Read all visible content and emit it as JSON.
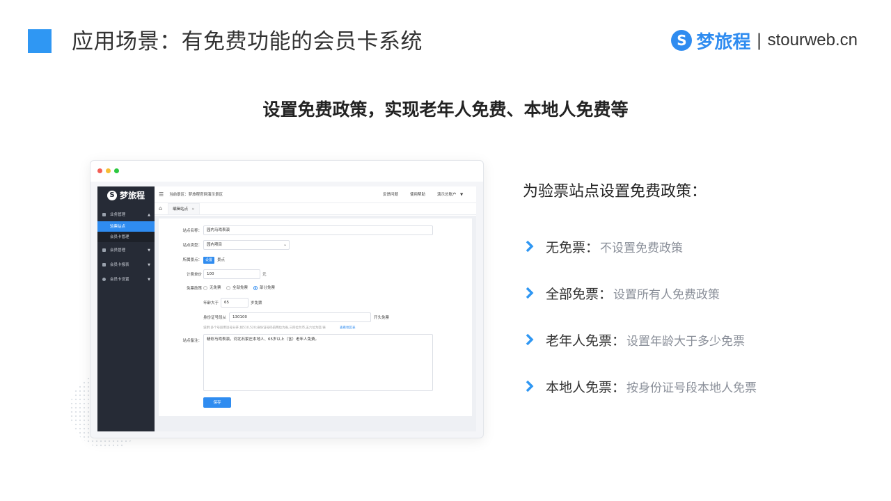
{
  "header": {
    "title": "应用场景：有免费功能的会员卡系统",
    "brand_name": "梦旅程",
    "brand_separator": "|",
    "brand_domain": "stourweb.cn",
    "accent_color": "#2f97f3"
  },
  "subtitle": "设置免费政策，实现老年人免费、本地人免费等",
  "app": {
    "logo_text": "梦旅程",
    "logo_letter": "S",
    "breadcrumb": "当前景区：梦旅程官网演示景区",
    "top_links": [
      "反馈问题",
      "使用帮助",
      "演示总账户"
    ],
    "top_caret": "▼",
    "menu_icon": "☰",
    "home_icon": "⌂",
    "tab_label": "编辑站点",
    "tab_close": "×",
    "sidebar": {
      "groups": [
        {
          "label": "业务管理",
          "caret": "▲"
        },
        {
          "label": "会员管理",
          "caret": "▼"
        },
        {
          "label": "会员卡报表",
          "caret": "▼"
        },
        {
          "label": "会员卡设置",
          "caret": "▼"
        }
      ],
      "sub_items": [
        "验票站点",
        "会员卡管理"
      ]
    },
    "form": {
      "site_name_label": "站点名称：",
      "site_name_value": "园内马戏表演",
      "site_type_label": "站点类型：",
      "site_type_value": "园内项目",
      "select_caret": "⌄",
      "scenic_label": "所属景点：",
      "scenic_tag": "设置",
      "scenic_plain": "景点",
      "price_label": "计费单价",
      "price_value": "100",
      "price_unit": "元",
      "free_policy_label": "免票政策",
      "policy_options": [
        "无免票",
        "全部免票",
        "部分免票"
      ],
      "age_label": "年龄大于",
      "age_value": "65",
      "age_suffix": "岁免票",
      "id_label": "身份证号段从",
      "id_value": "130100",
      "id_suffix": "开头免票",
      "id_hint": "说明:多个号段用逗号分开,如510,520;身份证号码前两位为省,三四位为市,五六位为区/县",
      "id_hint_link": "查看地区表",
      "note_label": "站点备注：",
      "note_value": "精彩马戏表演，河北石家庄本地人、65岁以上（含）老年人免费。",
      "save_label": "保存"
    }
  },
  "policies": {
    "heading": "为验票站点设置免费政策：",
    "items": [
      {
        "title": "无免票：",
        "desc": "不设置免费政策"
      },
      {
        "title": "全部免票：",
        "desc": "设置所有人免费政策"
      },
      {
        "title": "老年人免票：",
        "desc": "设置年龄大于多少免票"
      },
      {
        "title": "本地人免票：",
        "desc": "按身份证号段本地人免票"
      }
    ],
    "chevron_icon": "chevron-right-icon",
    "chevron_color": "#2f97f3"
  }
}
